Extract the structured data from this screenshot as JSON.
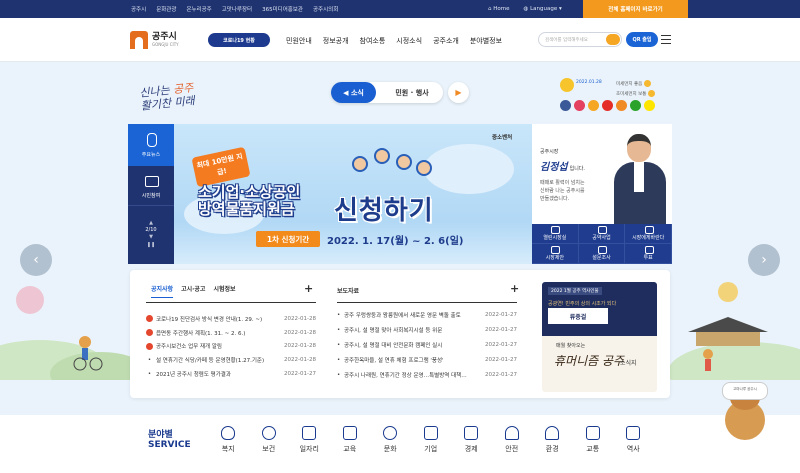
{
  "topbar": {
    "links": [
      "공주시",
      "문화관광",
      "온누리공주",
      "고맛나루장터",
      "365미디어홍보관",
      "공주시의회"
    ],
    "home": "Home",
    "language": "Language",
    "cta": "전체 홈페이지 바로가기"
  },
  "header": {
    "logo_name": "공주시",
    "logo_sub": "GONGJU CITY",
    "covid_btn": "코로나19 현황",
    "nav": [
      "민원안내",
      "정보공개",
      "참여소통",
      "시정소식",
      "공주소개",
      "분야별정보"
    ],
    "search_placeholder": "검색어를 입력해주세요",
    "qr_btn": "QR 출입"
  },
  "hero": {
    "slogan_line1_a": "신나는",
    "slogan_line1_b": "공주",
    "slogan_line2": "활기찬 미래",
    "tabs": [
      "소식",
      "민원 · 행사"
    ],
    "weather": {
      "date": "2022.01.28",
      "temp": "",
      "row1_label": "미세먼지",
      "row1_value": "좋음",
      "row2_label": "초미세먼지",
      "row2_value": "보통"
    },
    "colors": {
      "accent": "#1a5fd1",
      "navy": "#1f3370",
      "orange": "#f39a1e"
    }
  },
  "sidebar": {
    "item1": "주요뉴스",
    "item2": "시민참여",
    "pager": "2/10"
  },
  "banner": {
    "promo": "최대 10만원 지급!",
    "agency": "중소벤처",
    "headline_1": "소기업·소상공인",
    "headline_2": "방역물품지원금",
    "cta": "신청하기",
    "period_tag": "1차 신청기간",
    "period": "2022. 1. 17(월) ~ 2. 6(일)"
  },
  "mayor": {
    "title": "공주시장",
    "name": "김정섭",
    "suffix": "입니다.",
    "desc": "때때로 활력이 넘치는 신바람 나는 공주시를 만들겠습니다.",
    "menu": [
      "열린시장실",
      "공약사업",
      "시장에게바란다",
      "시장제안",
      "설문조사",
      "투표"
    ]
  },
  "news": {
    "tabs": [
      "공지사항",
      "고시·공고",
      "시험정보"
    ],
    "items": [
      {
        "text": "코로나19 진단검사 방식 변경 안내(1. 29. ~)",
        "date": "2022-01-28",
        "hot": true
      },
      {
        "text": "읍면동 주간행사 계획(1. 31. ~ 2. 6.)",
        "date": "2022-01-28",
        "hot": true
      },
      {
        "text": "공주시보건소 업무 재개 알림",
        "date": "2022-01-28",
        "hot": true
      },
      {
        "text": "설 연휴기간 식당/카페 등 운영현황(1.27.기준)",
        "date": "2022-01-28",
        "hot": false
      },
      {
        "text": "2021년 공주시 청렴도 평가결과",
        "date": "2022-01-27",
        "hot": false
      }
    ],
    "press_title": "보도자료",
    "press": [
      {
        "text": "공주 우렁쌍둥과 왕릉원에서 새로운 영문 벽돌 출토",
        "date": "2022-01-27"
      },
      {
        "text": "공주시, 설 명절 맞아 사회복지시설 등 위문",
        "date": "2022-01-27"
      },
      {
        "text": "공주시, 설 명절 대비 안전문화 캠페인 실시",
        "date": "2022-01-27"
      },
      {
        "text": "공주한옥마을, 설 연휴 체험 프로그램 '풍성'",
        "date": "2022-01-27"
      },
      {
        "text": "공주시 나래원, 연휴기간 정상 운영…특별방역 대책…",
        "date": "2022-01-27"
      }
    ]
  },
  "ad": {
    "label": "2022 1월 공주 역사인물",
    "line": "공광연! 빈주의 상의 시조가 되다",
    "hero": "류중걸",
    "bottom_small": "매월 찾아오는",
    "bottom_big": "휴머니즘 공주",
    "bottom_tail": "소식지"
  },
  "service": {
    "title_1": "분야별",
    "title_2": "SERVICE",
    "items": [
      "복지",
      "보건",
      "일자리",
      "교육",
      "문화",
      "기업",
      "경제",
      "안전",
      "환경",
      "교통",
      "역사"
    ]
  },
  "mascot": {
    "bubble": "고마나루 공주시"
  }
}
